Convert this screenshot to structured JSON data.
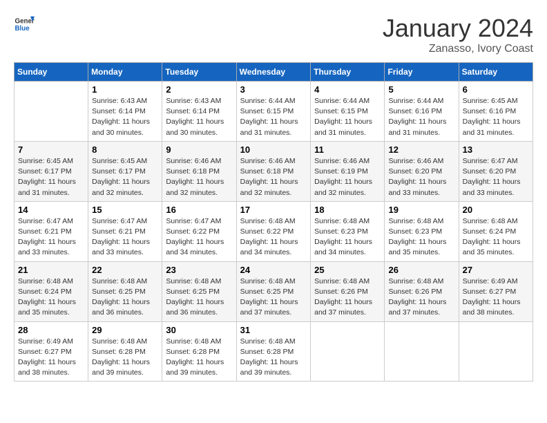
{
  "header": {
    "logo_line1": "General",
    "logo_line2": "Blue",
    "month": "January 2024",
    "location": "Zanasso, Ivory Coast"
  },
  "columns": [
    "Sunday",
    "Monday",
    "Tuesday",
    "Wednesday",
    "Thursday",
    "Friday",
    "Saturday"
  ],
  "weeks": [
    [
      {
        "num": "",
        "sunrise": "",
        "sunset": "",
        "daylight": ""
      },
      {
        "num": "1",
        "sunrise": "Sunrise: 6:43 AM",
        "sunset": "Sunset: 6:14 PM",
        "daylight": "Daylight: 11 hours and 30 minutes."
      },
      {
        "num": "2",
        "sunrise": "Sunrise: 6:43 AM",
        "sunset": "Sunset: 6:14 PM",
        "daylight": "Daylight: 11 hours and 30 minutes."
      },
      {
        "num": "3",
        "sunrise": "Sunrise: 6:44 AM",
        "sunset": "Sunset: 6:15 PM",
        "daylight": "Daylight: 11 hours and 31 minutes."
      },
      {
        "num": "4",
        "sunrise": "Sunrise: 6:44 AM",
        "sunset": "Sunset: 6:15 PM",
        "daylight": "Daylight: 11 hours and 31 minutes."
      },
      {
        "num": "5",
        "sunrise": "Sunrise: 6:44 AM",
        "sunset": "Sunset: 6:16 PM",
        "daylight": "Daylight: 11 hours and 31 minutes."
      },
      {
        "num": "6",
        "sunrise": "Sunrise: 6:45 AM",
        "sunset": "Sunset: 6:16 PM",
        "daylight": "Daylight: 11 hours and 31 minutes."
      }
    ],
    [
      {
        "num": "7",
        "sunrise": "Sunrise: 6:45 AM",
        "sunset": "Sunset: 6:17 PM",
        "daylight": "Daylight: 11 hours and 31 minutes."
      },
      {
        "num": "8",
        "sunrise": "Sunrise: 6:45 AM",
        "sunset": "Sunset: 6:17 PM",
        "daylight": "Daylight: 11 hours and 32 minutes."
      },
      {
        "num": "9",
        "sunrise": "Sunrise: 6:46 AM",
        "sunset": "Sunset: 6:18 PM",
        "daylight": "Daylight: 11 hours and 32 minutes."
      },
      {
        "num": "10",
        "sunrise": "Sunrise: 6:46 AM",
        "sunset": "Sunset: 6:18 PM",
        "daylight": "Daylight: 11 hours and 32 minutes."
      },
      {
        "num": "11",
        "sunrise": "Sunrise: 6:46 AM",
        "sunset": "Sunset: 6:19 PM",
        "daylight": "Daylight: 11 hours and 32 minutes."
      },
      {
        "num": "12",
        "sunrise": "Sunrise: 6:46 AM",
        "sunset": "Sunset: 6:20 PM",
        "daylight": "Daylight: 11 hours and 33 minutes."
      },
      {
        "num": "13",
        "sunrise": "Sunrise: 6:47 AM",
        "sunset": "Sunset: 6:20 PM",
        "daylight": "Daylight: 11 hours and 33 minutes."
      }
    ],
    [
      {
        "num": "14",
        "sunrise": "Sunrise: 6:47 AM",
        "sunset": "Sunset: 6:21 PM",
        "daylight": "Daylight: 11 hours and 33 minutes."
      },
      {
        "num": "15",
        "sunrise": "Sunrise: 6:47 AM",
        "sunset": "Sunset: 6:21 PM",
        "daylight": "Daylight: 11 hours and 33 minutes."
      },
      {
        "num": "16",
        "sunrise": "Sunrise: 6:47 AM",
        "sunset": "Sunset: 6:22 PM",
        "daylight": "Daylight: 11 hours and 34 minutes."
      },
      {
        "num": "17",
        "sunrise": "Sunrise: 6:48 AM",
        "sunset": "Sunset: 6:22 PM",
        "daylight": "Daylight: 11 hours and 34 minutes."
      },
      {
        "num": "18",
        "sunrise": "Sunrise: 6:48 AM",
        "sunset": "Sunset: 6:23 PM",
        "daylight": "Daylight: 11 hours and 34 minutes."
      },
      {
        "num": "19",
        "sunrise": "Sunrise: 6:48 AM",
        "sunset": "Sunset: 6:23 PM",
        "daylight": "Daylight: 11 hours and 35 minutes."
      },
      {
        "num": "20",
        "sunrise": "Sunrise: 6:48 AM",
        "sunset": "Sunset: 6:24 PM",
        "daylight": "Daylight: 11 hours and 35 minutes."
      }
    ],
    [
      {
        "num": "21",
        "sunrise": "Sunrise: 6:48 AM",
        "sunset": "Sunset: 6:24 PM",
        "daylight": "Daylight: 11 hours and 35 minutes."
      },
      {
        "num": "22",
        "sunrise": "Sunrise: 6:48 AM",
        "sunset": "Sunset: 6:25 PM",
        "daylight": "Daylight: 11 hours and 36 minutes."
      },
      {
        "num": "23",
        "sunrise": "Sunrise: 6:48 AM",
        "sunset": "Sunset: 6:25 PM",
        "daylight": "Daylight: 11 hours and 36 minutes."
      },
      {
        "num": "24",
        "sunrise": "Sunrise: 6:48 AM",
        "sunset": "Sunset: 6:25 PM",
        "daylight": "Daylight: 11 hours and 37 minutes."
      },
      {
        "num": "25",
        "sunrise": "Sunrise: 6:48 AM",
        "sunset": "Sunset: 6:26 PM",
        "daylight": "Daylight: 11 hours and 37 minutes."
      },
      {
        "num": "26",
        "sunrise": "Sunrise: 6:48 AM",
        "sunset": "Sunset: 6:26 PM",
        "daylight": "Daylight: 11 hours and 37 minutes."
      },
      {
        "num": "27",
        "sunrise": "Sunrise: 6:49 AM",
        "sunset": "Sunset: 6:27 PM",
        "daylight": "Daylight: 11 hours and 38 minutes."
      }
    ],
    [
      {
        "num": "28",
        "sunrise": "Sunrise: 6:49 AM",
        "sunset": "Sunset: 6:27 PM",
        "daylight": "Daylight: 11 hours and 38 minutes."
      },
      {
        "num": "29",
        "sunrise": "Sunrise: 6:48 AM",
        "sunset": "Sunset: 6:28 PM",
        "daylight": "Daylight: 11 hours and 39 minutes."
      },
      {
        "num": "30",
        "sunrise": "Sunrise: 6:48 AM",
        "sunset": "Sunset: 6:28 PM",
        "daylight": "Daylight: 11 hours and 39 minutes."
      },
      {
        "num": "31",
        "sunrise": "Sunrise: 6:48 AM",
        "sunset": "Sunset: 6:28 PM",
        "daylight": "Daylight: 11 hours and 39 minutes."
      },
      {
        "num": "",
        "sunrise": "",
        "sunset": "",
        "daylight": ""
      },
      {
        "num": "",
        "sunrise": "",
        "sunset": "",
        "daylight": ""
      },
      {
        "num": "",
        "sunrise": "",
        "sunset": "",
        "daylight": ""
      }
    ]
  ]
}
